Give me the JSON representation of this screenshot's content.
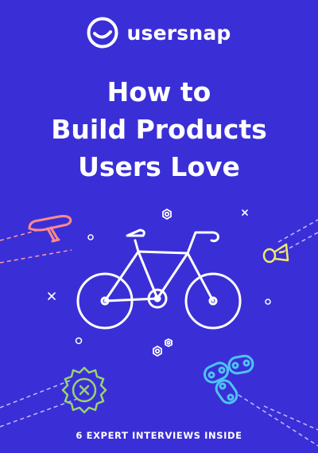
{
  "brand": {
    "name": "usersnap",
    "logo_icon": "usersnap-smile-icon"
  },
  "title": {
    "line1": "How to",
    "line2": "Build Products",
    "line3": "Users Love"
  },
  "footer": {
    "text": "6 EXPERT INTERVIEWS INSIDE"
  },
  "illustration": {
    "icons": [
      "bicycle-icon",
      "saddle-icon",
      "bell-icon",
      "gear-icon",
      "chain-icon",
      "nut-icon",
      "sparkle-icon",
      "circle-icon"
    ]
  },
  "colors": {
    "background": "#3a2fd6",
    "text": "#ffffff",
    "saddle": "#ff8a8a",
    "bell": "#f3ea62",
    "gear": "#9ad36b",
    "chain": "#4ec3f5",
    "dashes": "#ff9aa2",
    "dashes_right": "#c9b8ff"
  }
}
